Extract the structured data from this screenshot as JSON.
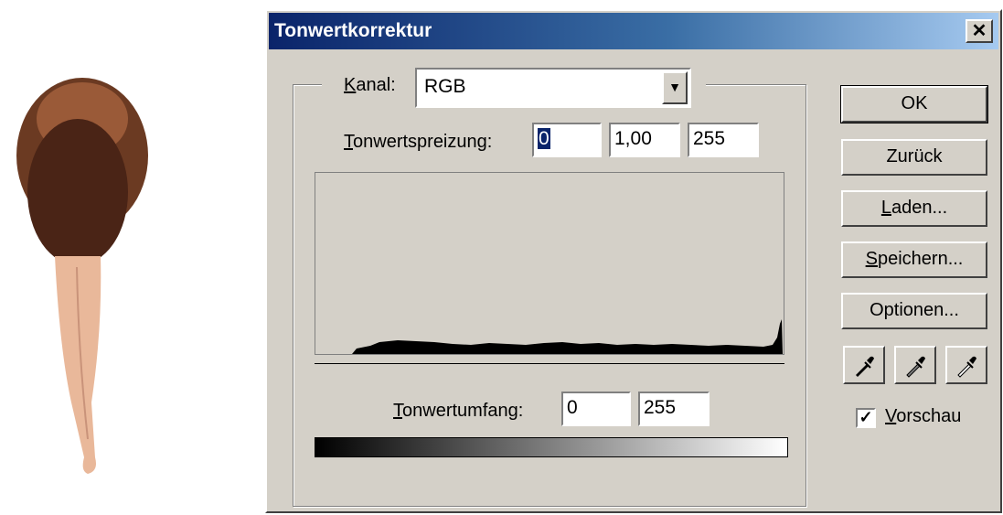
{
  "dialog": {
    "title": "Tonwertkorrektur",
    "close_glyph": "✕"
  },
  "channel": {
    "label_prefix": "K",
    "label_rest": "anal:",
    "value": "RGB",
    "dropdown_glyph": "▼"
  },
  "input_levels": {
    "label_prefix": "T",
    "label_rest": "onwertspreizung:",
    "black": "0",
    "gamma": "1,00",
    "white": "255"
  },
  "output_levels": {
    "label_prefix": "T",
    "label_rest": "onwertumfang:",
    "black": "0",
    "white": "255"
  },
  "buttons": {
    "ok": "OK",
    "reset": "Zurück",
    "load_prefix": "L",
    "load_rest": "aden...",
    "save_prefix": "S",
    "save_rest": "peichern...",
    "options": "Optionen..."
  },
  "preview": {
    "checked": true,
    "check_glyph": "✓",
    "label_prefix": "V",
    "label_rest": "orschau"
  },
  "eyedroppers": [
    "black-point-eyedropper-icon",
    "gray-point-eyedropper-icon",
    "white-point-eyedropper-icon"
  ],
  "colors": {
    "dialog_bg": "#d4d0c8",
    "title_start": "#0a246a",
    "title_end": "#a6caf0",
    "selection": "#0a246a"
  }
}
